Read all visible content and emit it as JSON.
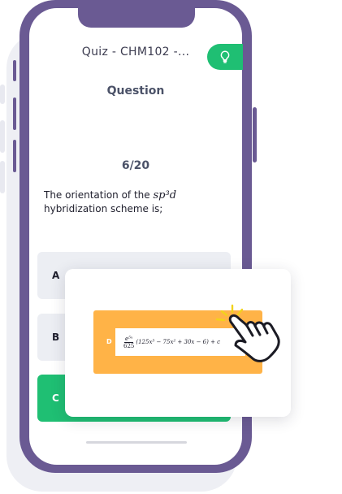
{
  "header": {
    "title": "Quiz - CHM102 -...",
    "hint_icon": "lightbulb-icon"
  },
  "section_heading": "Question",
  "counter": "6/20",
  "question": {
    "prefix": "The orientation of the",
    "math": "sp³d",
    "suffix": "hybridization scheme is;"
  },
  "options": [
    {
      "letter": "A"
    },
    {
      "letter": "B"
    },
    {
      "letter": "C",
      "state": "correct"
    }
  ],
  "popup": {
    "letter": "D",
    "fraction_numerator": "e⁵ˣ",
    "fraction_denominator": "625",
    "expression": "(125x³ − 75x² + 30x − 6) + c",
    "pointer_icon": "hand-pointer-icon"
  },
  "colors": {
    "phone_frame": "#6a5a93",
    "accent_green": "#1fbf73",
    "answer_orange": "#ffb347",
    "option_gray": "#eceef3"
  }
}
